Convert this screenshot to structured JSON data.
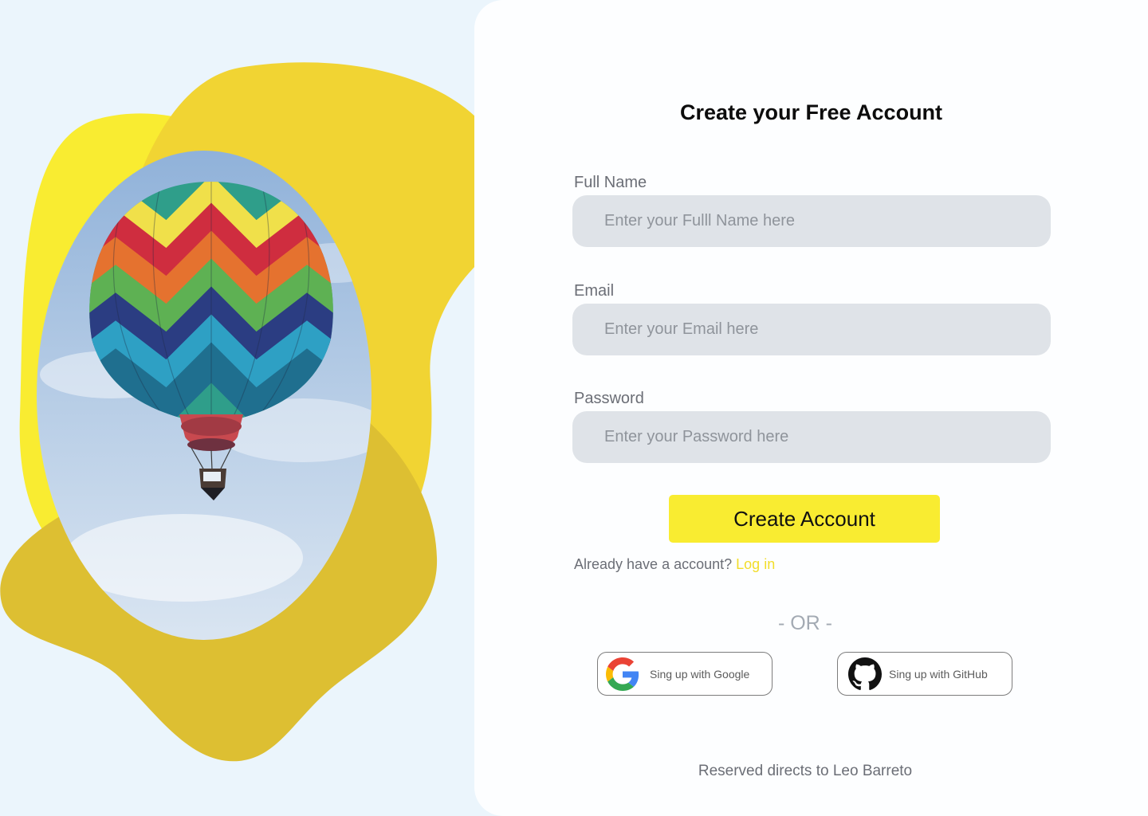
{
  "hero": {
    "image_description_icon": "hot-air-balloon",
    "colors": {
      "blob_light": "#f9ec31",
      "blob_mid": "#f1d433",
      "blob_dark": "#ddbf32"
    }
  },
  "form": {
    "title": "Create your Free Account",
    "fields": [
      {
        "label": "Full Name",
        "placeholder": "Enter your Fulll Name here",
        "value": ""
      },
      {
        "label": "Email",
        "placeholder": "Enter your Email here",
        "value": ""
      },
      {
        "label": "Password",
        "placeholder": "Enter your Password here",
        "value": ""
      }
    ],
    "submit_label": "Create Account",
    "login_prompt": "Already have a account?",
    "login_link": "Log in",
    "divider": "- OR -",
    "social": {
      "google_label": "Sing up with Google",
      "google_icon": "google-icon",
      "github_label": "Sing up with GitHub",
      "github_icon": "github-icon"
    },
    "footer": "Reserved directs to Leo Barreto"
  },
  "theme": {
    "page_bg": "#ebf5fc",
    "card_bg": "#fdfeff",
    "input_bg": "#dfe3e8",
    "accent": "#f9ec31",
    "link": "#f2dd29"
  }
}
